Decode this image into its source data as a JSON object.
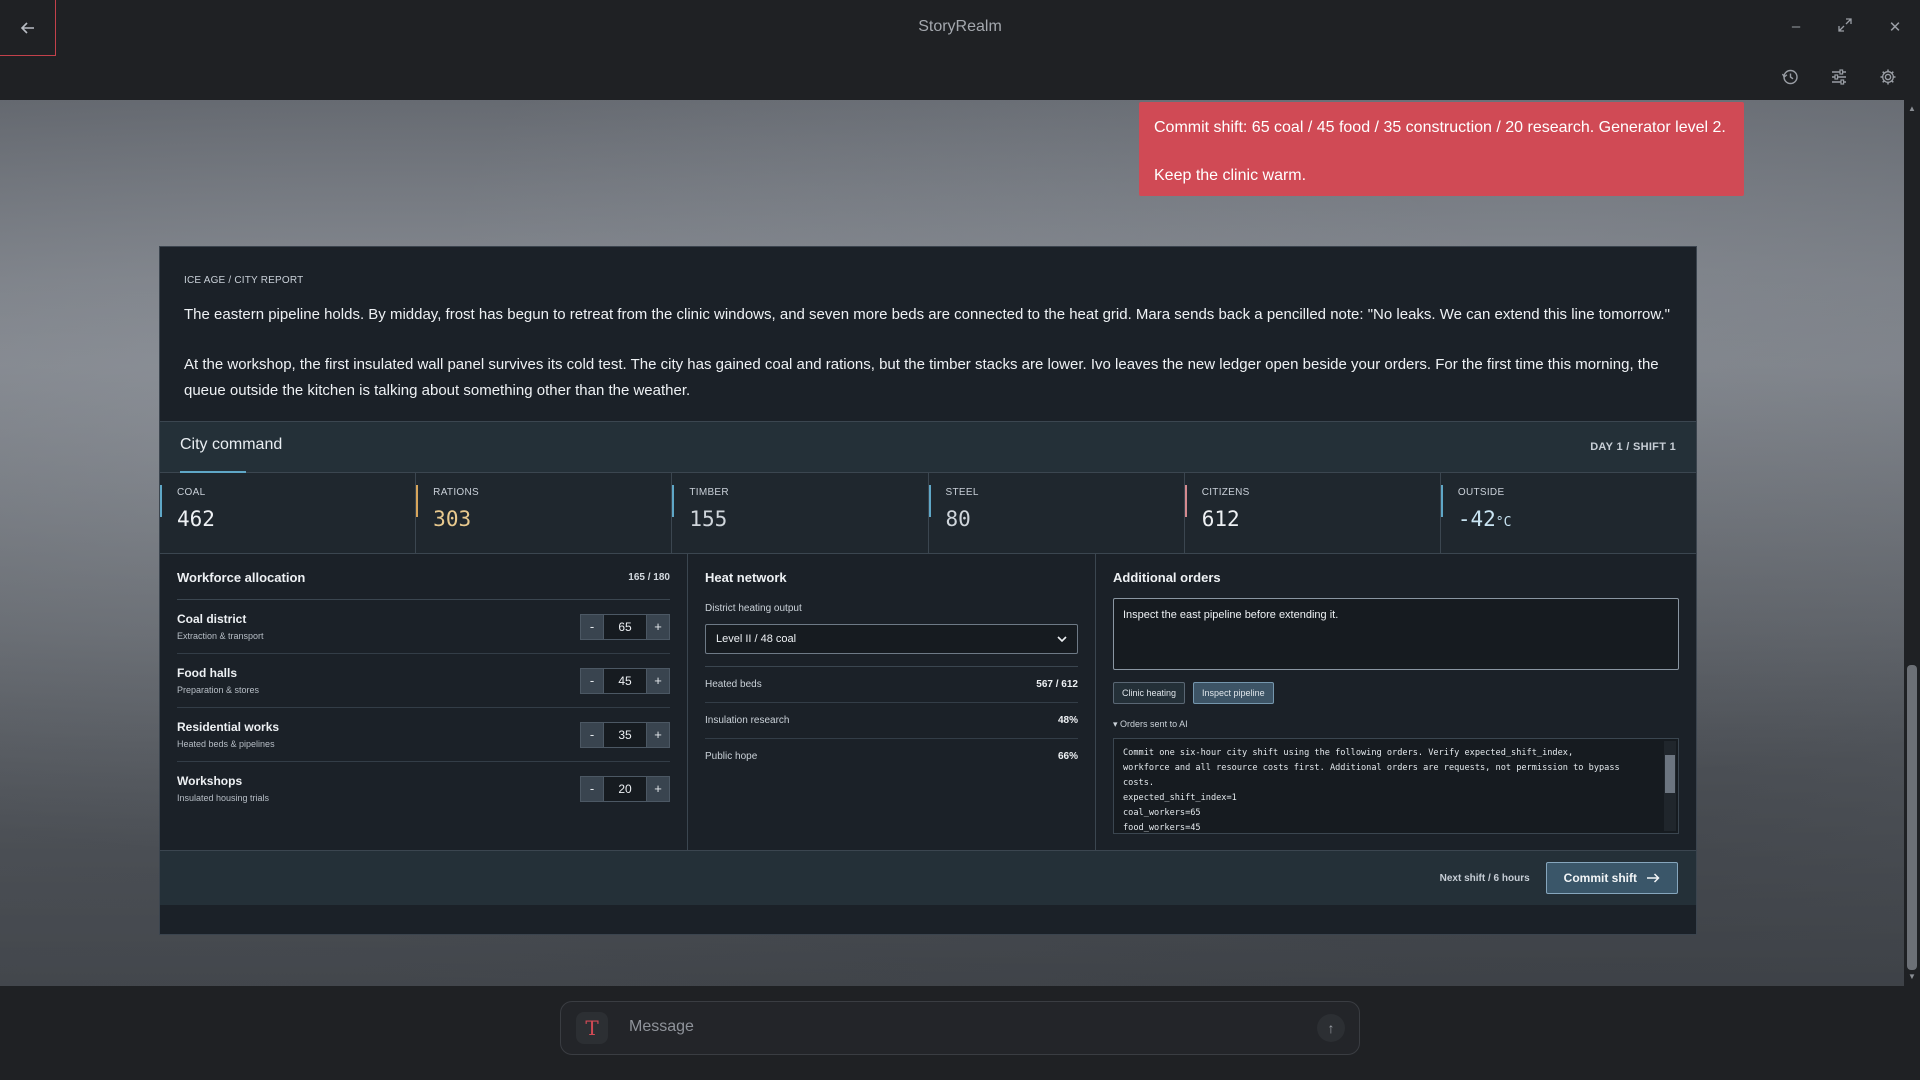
{
  "app": {
    "title": "StoryRealm"
  },
  "toast": {
    "line1": "Commit shift: 65 coal / 45 food / 35 construction / 20 research. Generator level 2.",
    "line2": "Keep the clinic warm."
  },
  "report": {
    "eyebrow": "ICE AGE / CITY REPORT",
    "p1": "The eastern pipeline holds. By midday, frost has begun to retreat from the clinic windows, and seven more beds are connected to the heat grid. Mara sends back a pencilled note: \"No leaks. We can extend this line tomorrow.\"",
    "p2": "At the workshop, the first insulated wall panel survives its cold test. The city has gained coal and rations, but the timber stacks are lower. Ivo leaves the new ledger open beside your orders. For the first time this morning, the queue outside the kitchen is talking about something other than the weather."
  },
  "command": {
    "tab": "City command",
    "day": "DAY 1   /   SHIFT 1"
  },
  "stats": [
    {
      "label": "COAL",
      "value": "462",
      "unit": "",
      "value_color": "#eef1f4",
      "bar_color": "#5fa7c7"
    },
    {
      "label": "RATIONS",
      "value": "303",
      "unit": "",
      "value_color": "#e8c98e",
      "bar_color": "#d7a55b"
    },
    {
      "label": "TIMBER",
      "value": "155",
      "unit": "",
      "value_color": "#cfd5db",
      "bar_color": "#5fa7c7"
    },
    {
      "label": "STEEL",
      "value": "80",
      "unit": "",
      "value_color": "#cfd5db",
      "bar_color": "#5fa7c7"
    },
    {
      "label": "CITIZENS",
      "value": "612",
      "unit": "",
      "value_color": "#eef1f4",
      "bar_color": "#d58a8f"
    },
    {
      "label": "OUTSIDE",
      "value": "-42",
      "unit": "°C",
      "value_color": "#c9e4f2",
      "bar_color": "#5fa7c7"
    }
  ],
  "workforce": {
    "title": "Workforce allocation",
    "count": "165 / 180",
    "rows": [
      {
        "name": "Coal district",
        "sub": "Extraction & transport",
        "value": "65"
      },
      {
        "name": "Food halls",
        "sub": "Preparation & stores",
        "value": "45"
      },
      {
        "name": "Residential works",
        "sub": "Heated beds & pipelines",
        "value": "35"
      },
      {
        "name": "Workshops",
        "sub": "Insulated housing trials",
        "value": "20"
      }
    ],
    "minus": "-",
    "plus": "+"
  },
  "heat": {
    "title": "Heat network",
    "output_label": "District heating output",
    "output_value": "Level II / 48 coal",
    "rows": [
      {
        "label": "Heated beds",
        "value": "567 / 612"
      },
      {
        "label": "Insulation research",
        "value": "48%"
      },
      {
        "label": "Public hope",
        "value": "66%"
      }
    ]
  },
  "orders": {
    "title": "Additional orders",
    "text": "Inspect the east pipeline before extending it.",
    "chips": [
      "Clinic heating",
      "Inspect pipeline"
    ],
    "summary": "Orders sent to AI",
    "code": [
      "Commit one six-hour city shift using the following orders. Verify expected_shift_index,",
      "workforce and all resource costs first. Additional orders are requests, not permission to bypass",
      "costs.",
      "expected_shift_index=1",
      "coal_workers=65",
      "food_workers=45"
    ]
  },
  "footer": {
    "note": "Next shift / 6 hours",
    "commit_label": "Commit shift"
  },
  "composer": {
    "placeholder": "Message",
    "icon_letter": "T"
  }
}
